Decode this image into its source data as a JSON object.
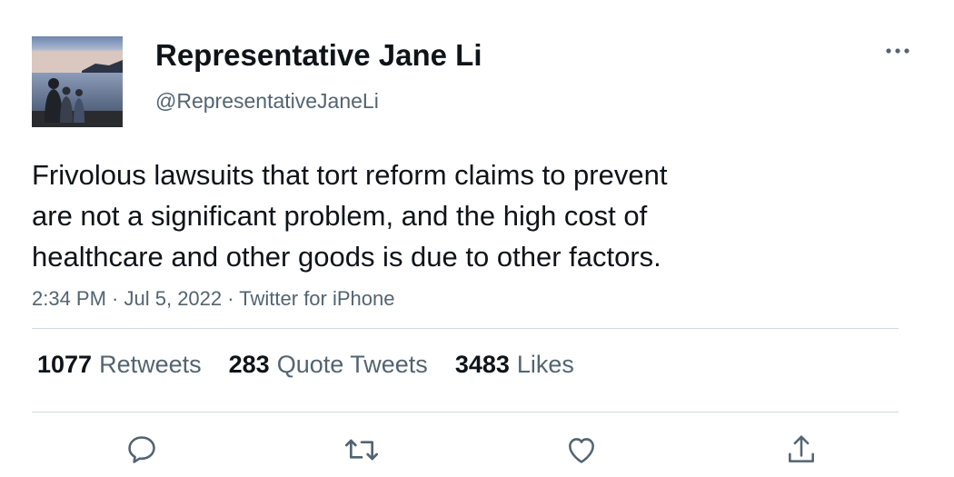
{
  "author": {
    "display_name": "Representative Jane Li",
    "handle": "@RepresentativeJaneLi",
    "avatar_description": "avatar-photo"
  },
  "tweet": {
    "text": "Frivolous lawsuits that tort reform claims to prevent\nare not a significant problem, and the high cost of\nhealthcare and other goods is due to other factors.",
    "time": "2:34 PM",
    "date": "Jul 5, 2022",
    "source": "Twitter for iPhone",
    "separator": " · "
  },
  "stats": {
    "retweets": {
      "count": "1077",
      "label": "Retweets"
    },
    "quote_tweets": {
      "count": "283",
      "label": "Quote Tweets"
    },
    "likes": {
      "count": "3483",
      "label": "Likes"
    }
  },
  "icons": {
    "more": "more-icon",
    "reply": "reply-icon",
    "retweet": "retweet-icon",
    "like": "heart-icon",
    "share": "share-icon"
  },
  "colors": {
    "text_primary": "#0f1419",
    "text_secondary": "#536471",
    "divider": "#cfd9de"
  }
}
